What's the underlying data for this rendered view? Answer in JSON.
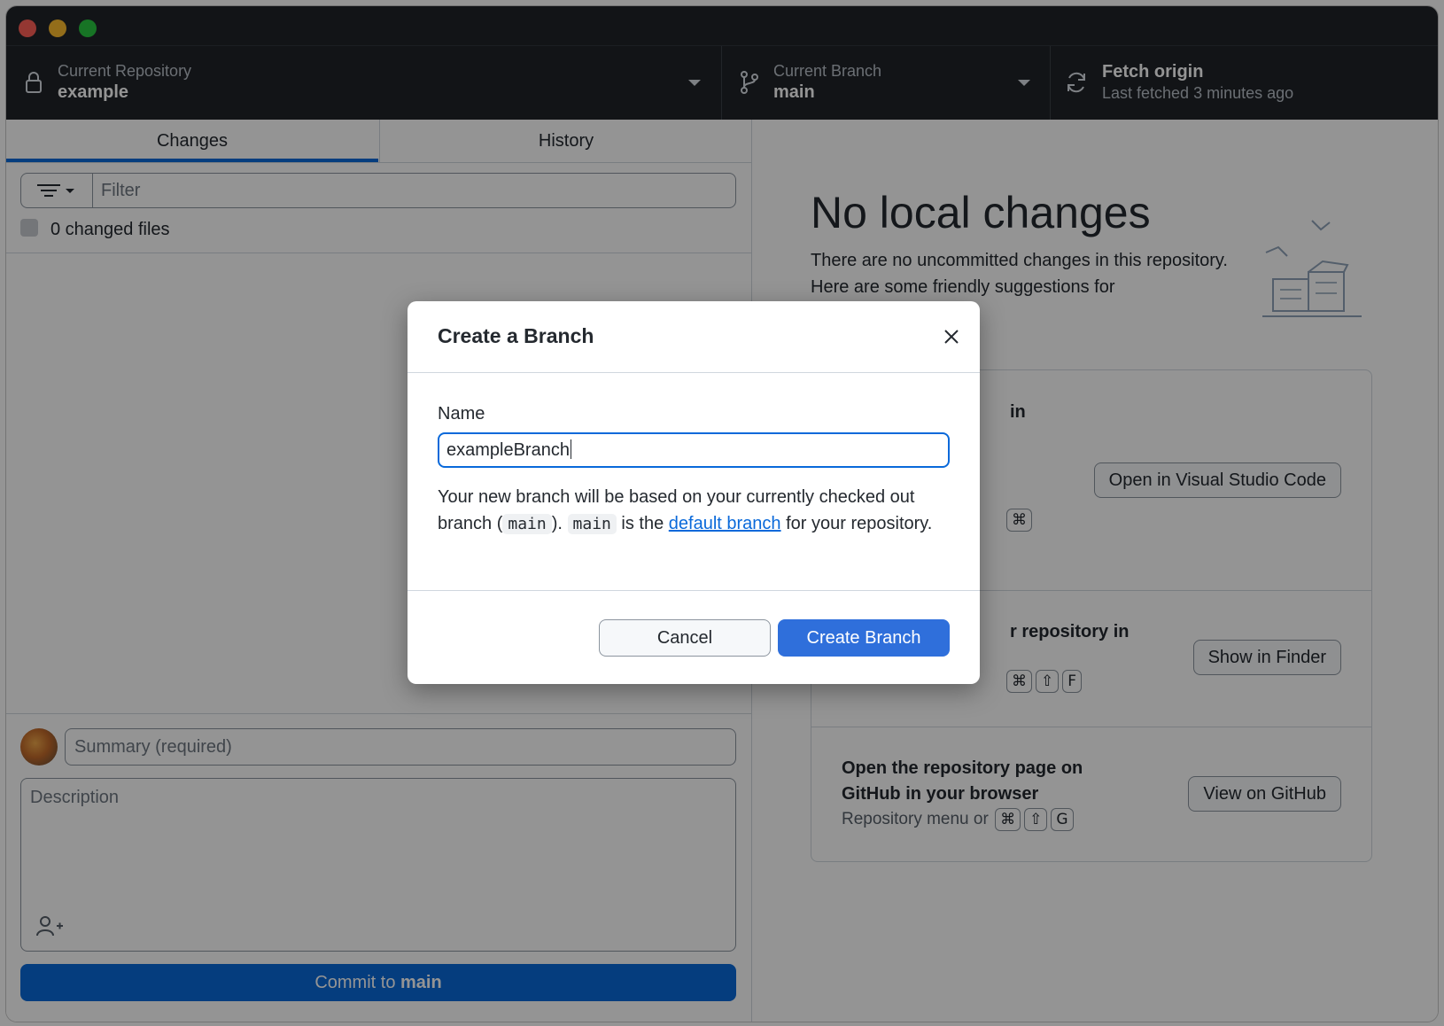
{
  "toolbar": {
    "repo_label": "Current Repository",
    "repo_value": "example",
    "branch_label": "Current Branch",
    "branch_value": "main",
    "fetch_title": "Fetch origin",
    "fetch_sub": "Last fetched 3 minutes ago"
  },
  "sidebar": {
    "tabs": [
      {
        "label": "Changes"
      },
      {
        "label": "History"
      }
    ],
    "filter_placeholder": "Filter",
    "changed_files": "0 changed files",
    "summary_placeholder": "Summary (required)",
    "description_placeholder": "Description",
    "commit_prefix": "Commit to ",
    "commit_branch": "main"
  },
  "main": {
    "title": "No local changes",
    "description": "There are no uncommitted changes in this repository. Here are some friendly suggestions for",
    "items": [
      {
        "title_fragment": "in",
        "button": "Open in Visual Studio Code",
        "kbd": "⌘"
      },
      {
        "title_fragment": "r repository in",
        "button": "Show in Finder",
        "kbd1": "⌘",
        "kbd2": "⇧",
        "kbd3": "F"
      },
      {
        "title_line1": "Open the repository page on",
        "title_line2": "GitHub in your browser",
        "sub": "Repository menu or",
        "button": "View on GitHub",
        "kbd1": "⌘",
        "kbd2": "⇧",
        "kbd3": "G"
      }
    ]
  },
  "dialog": {
    "title": "Create a Branch",
    "name_label": "Name",
    "name_value": "exampleBranch",
    "text_part1": "Your new branch will be based on your currently checked out branch (",
    "code1": "main",
    "text_part2": "). ",
    "code2": "main",
    "text_part3": " is the ",
    "link": "default branch",
    "text_part4": " for your repository.",
    "cancel": "Cancel",
    "create": "Create Branch"
  },
  "colors": {
    "accent": "#0969da",
    "titlebar": "#1f2328",
    "primary_button": "#2f6fdb"
  }
}
